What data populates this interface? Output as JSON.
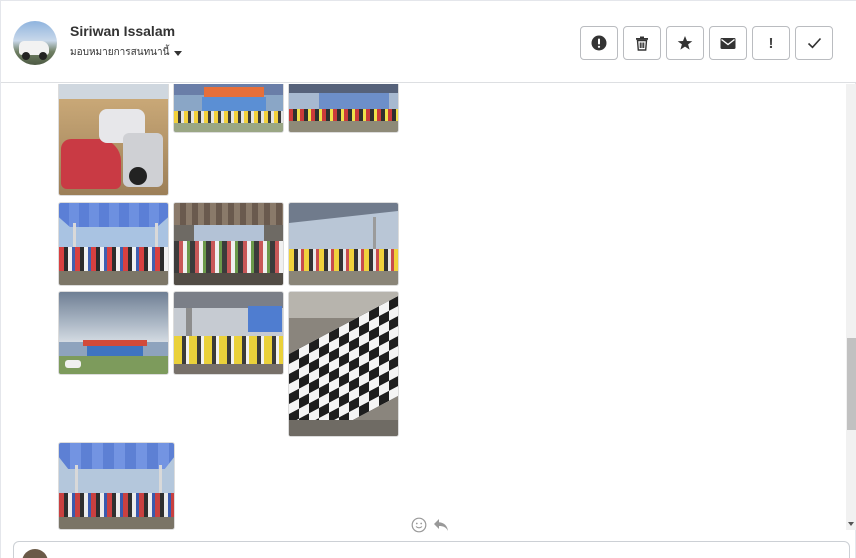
{
  "conversation": {
    "contact_name": "Siriwan Issalam",
    "assign_label": "มอบหมายการสนทนานี้"
  },
  "toolbar": {
    "buttons": [
      {
        "icon": "alert-circle-icon",
        "label": "Mark as spam"
      },
      {
        "icon": "trash-icon",
        "label": "Delete"
      },
      {
        "icon": "star-icon",
        "label": "Star"
      },
      {
        "icon": "envelope-icon",
        "label": "Mark as unread"
      },
      {
        "icon": "exclamation-icon",
        "label": "!"
      },
      {
        "icon": "check-icon",
        "label": "Done"
      }
    ],
    "exclamation_text": "!"
  },
  "photos": [
    {
      "scene": "motorbikes-parking"
    },
    {
      "scene": "tent-building"
    },
    {
      "scene": "tent-building-wide"
    },
    {
      "scene": "tent-crowd"
    },
    {
      "scene": "crowd-seated"
    },
    {
      "scene": "crowd-bikes"
    },
    {
      "scene": "cloudy-sky-building"
    },
    {
      "scene": "seated-yellow-shirts"
    },
    {
      "scene": "checkered-table"
    },
    {
      "scene": "tent-crowd-2"
    }
  ],
  "colors": {
    "border": "#babcc0",
    "text": "#333333",
    "accent_blue": "#3b5fc4"
  }
}
